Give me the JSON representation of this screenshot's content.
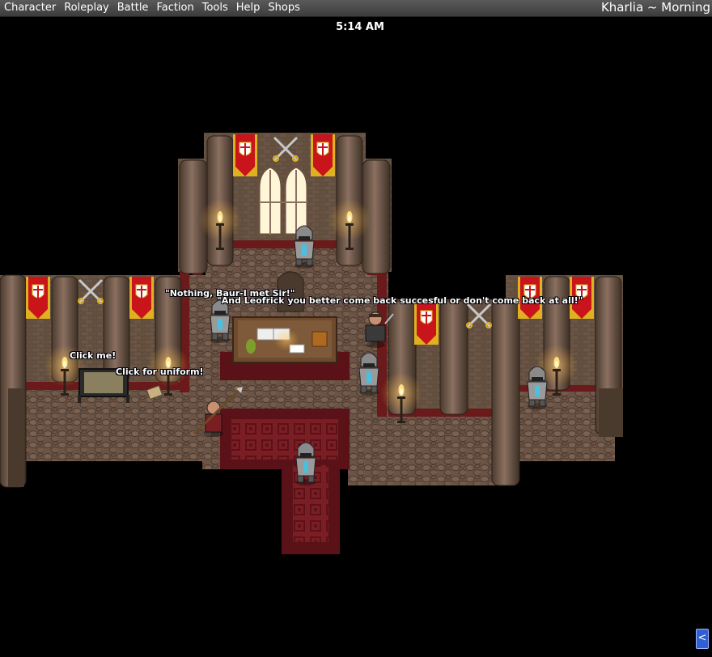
{
  "menu": {
    "items": [
      {
        "id": "character",
        "label": "Character"
      },
      {
        "id": "roleplay",
        "label": "Roleplay"
      },
      {
        "id": "battle",
        "label": "Battle"
      },
      {
        "id": "faction",
        "label": "Faction"
      },
      {
        "id": "tools",
        "label": "Tools"
      },
      {
        "id": "help",
        "label": "Help"
      },
      {
        "id": "shops",
        "label": "Shops"
      }
    ],
    "location": "Kharlia ~ Morning"
  },
  "clock": "5:14 AM",
  "labels": {
    "speech_baur": "\"Nothing, Baur-I met Sir!\"",
    "speech_leofrick": "\"And Leofrick you better come back succesful or don't come back at all!\"",
    "click_me": "Click me!",
    "click_uniform": "Click for uniform!"
  },
  "collapse_button": "<",
  "colors": {
    "floor": "#6b5446",
    "wall_brick": "#5a4636",
    "pillar": "#7a6250",
    "carpet": "#7a1e24",
    "banner_red": "#c8141a",
    "banner_gold": "#e0b020"
  }
}
